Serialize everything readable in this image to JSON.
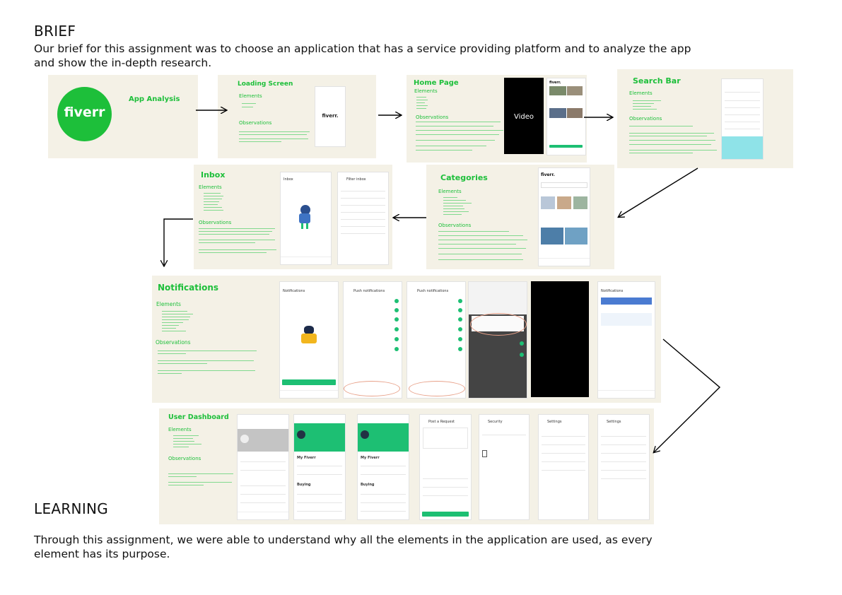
{
  "brief": {
    "heading": "BRIEF",
    "line1": "Our brief for this assignment was to choose an application that has a service providing platform and to analyze the app",
    "line2": "and show the in-depth research."
  },
  "learning": {
    "heading": "LEARNING",
    "line1": "Through this assignment, we were able to understand why all the elements in the application are used, as every",
    "line2": "element has its purpose."
  },
  "panels": {
    "analysis": {
      "logo": "fiverr",
      "title": "App Analysis"
    },
    "loading": {
      "title": "Loading Screen",
      "elements": "Elements",
      "observations": "Observations",
      "logo": "fiverr."
    },
    "home": {
      "title": "Home Page",
      "elements": "Elements",
      "observations": "Observations",
      "video": "Video",
      "logo": "fiverr."
    },
    "search": {
      "title": "Search Bar",
      "elements": "Elements",
      "observations": "Observations"
    },
    "categories": {
      "title": "Categories",
      "elements": "Elements",
      "observations": "Observations",
      "logo": "fiverr."
    },
    "inbox": {
      "title": "Inbox",
      "elements": "Elements",
      "observations": "Observations",
      "screen_title": "Inbox",
      "filter_title": "Filter inbox"
    },
    "notifications": {
      "title": "Notifications",
      "elements": "Elements",
      "observations": "Observations",
      "screen1": "Notifications",
      "screen2": "Push notifications",
      "screen3": "Push notifications",
      "screen6": "Notifications"
    },
    "dashboard": {
      "title": "User Dashboard",
      "elements": "Elements",
      "observations": "Observations",
      "my_fiverr": "My Fiverr",
      "buying": "Buying",
      "post_request": "Post a Request",
      "security": "Security",
      "settings": "Settings"
    }
  },
  "colors": {
    "fiverr_green": "#1dbf73",
    "title_green": "#1dbf3a",
    "panel_bg": "#f4f1e6",
    "highlight": "#e8a189"
  }
}
